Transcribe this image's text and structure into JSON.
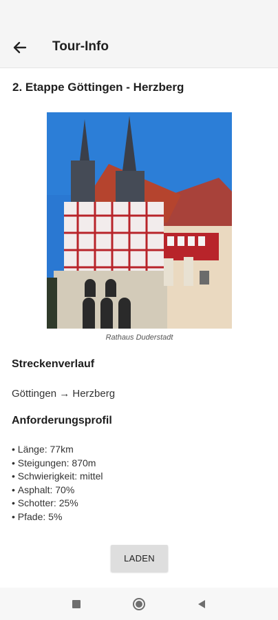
{
  "appbar": {
    "title": "Tour-Info",
    "back_icon": "arrow-left-icon"
  },
  "page": {
    "title": "2. Etappe Göttingen - Herzberg"
  },
  "photo": {
    "caption": "Rathaus Duderstadt"
  },
  "route_section": {
    "heading": "Streckenverlauf",
    "route_text": "Göttingen → Herzberg"
  },
  "requirements": {
    "heading": "Anforderungsprofil",
    "items": [
      "Länge: 77km",
      "Steigungen: 870m",
      "Schwierigkeit: mittel",
      "Asphalt: 70%",
      "Schotter: 25%",
      "Pfade: 5%"
    ]
  },
  "actions": {
    "load_label": "LADEN"
  },
  "navbar": {
    "icons": [
      "recents-square-icon",
      "home-circle-icon",
      "back-triangle-icon"
    ]
  },
  "colors": {
    "appbar_bg": "#f5f5f5",
    "button_bg": "#dedede",
    "sky": "#2a78d2",
    "timber_red": "#b8242a"
  }
}
